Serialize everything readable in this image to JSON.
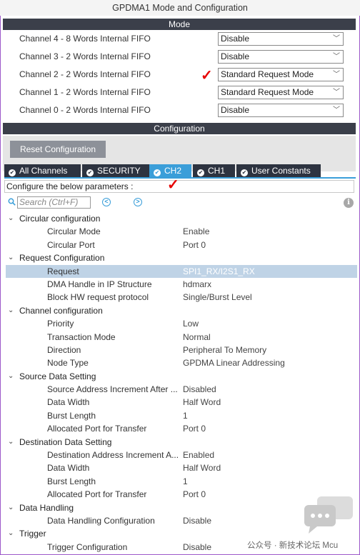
{
  "window": {
    "title": "GPDMA1 Mode and Configuration"
  },
  "mode": {
    "header": "Mode",
    "channels": [
      {
        "label": "Channel 4  - 8 Words Internal FIFO",
        "value": "Disable"
      },
      {
        "label": "Channel 3  - 2 Words Internal FIFO",
        "value": "Disable"
      },
      {
        "label": "Channel 2  - 2 Words Internal FIFO",
        "value": "Standard Request Mode",
        "checked": true
      },
      {
        "label": "Channel 1  - 2 Words Internal FIFO",
        "value": "Standard Request Mode"
      },
      {
        "label": "Channel 0  - 2 Words Internal FIFO",
        "value": "Disable"
      }
    ]
  },
  "configuration": {
    "header": "Configuration",
    "reset_label": "Reset Configuration",
    "tabs": [
      "All Channels",
      "SECURITY",
      "CH2",
      "CH1",
      "User Constants"
    ],
    "active_tab": "CH2",
    "params_caption": "Configure the below parameters :",
    "search_placeholder": "Search (Ctrl+F)"
  },
  "tree": [
    {
      "group": "Circular configuration",
      "items": [
        {
          "name": "Circular Mode",
          "value": "Enable"
        },
        {
          "name": "Circular Port",
          "value": "Port 0"
        }
      ]
    },
    {
      "group": "Request Configuration",
      "items": [
        {
          "name": "Request",
          "value": "SPI1_RX/I2S1_RX",
          "selected": true
        },
        {
          "name": "DMA Handle in IP Structure",
          "value": "hdmarx"
        },
        {
          "name": "Block HW request protocol",
          "value": "Single/Burst Level"
        }
      ]
    },
    {
      "group": "Channel configuration",
      "items": [
        {
          "name": "Priority",
          "value": "Low"
        },
        {
          "name": "Transaction Mode",
          "value": "Normal"
        },
        {
          "name": "Direction",
          "value": "Peripheral To Memory"
        },
        {
          "name": "Node Type",
          "value": "GPDMA Linear Addressing"
        }
      ]
    },
    {
      "group": "Source Data Setting",
      "items": [
        {
          "name": "Source Address Increment After ...",
          "value": "Disabled"
        },
        {
          "name": "Data Width",
          "value": "Half Word"
        },
        {
          "name": "Burst Length",
          "value": "1"
        },
        {
          "name": "Allocated Port for Transfer",
          "value": "Port 0"
        }
      ]
    },
    {
      "group": "Destination Data Setting",
      "items": [
        {
          "name": "Destination Address Increment A...",
          "value": "Enabled"
        },
        {
          "name": "Data Width",
          "value": "Half Word"
        },
        {
          "name": "Burst Length",
          "value": "1"
        },
        {
          "name": "Allocated Port for Transfer",
          "value": "Port 0"
        }
      ]
    },
    {
      "group": "Data Handling",
      "items": [
        {
          "name": "Data Handling Configuration",
          "value": "Disable"
        }
      ]
    },
    {
      "group": "Trigger",
      "items": [
        {
          "name": "Trigger Configuration",
          "value": "Disable"
        }
      ]
    }
  ],
  "watermark": {
    "text": "公众号 · 新技术论坛 Mcu"
  },
  "colors": {
    "accent": "#3a9ed9",
    "dark_bar": "#3b3f4a",
    "check_mark": "#e60000",
    "selection": "#bfd3e6"
  }
}
